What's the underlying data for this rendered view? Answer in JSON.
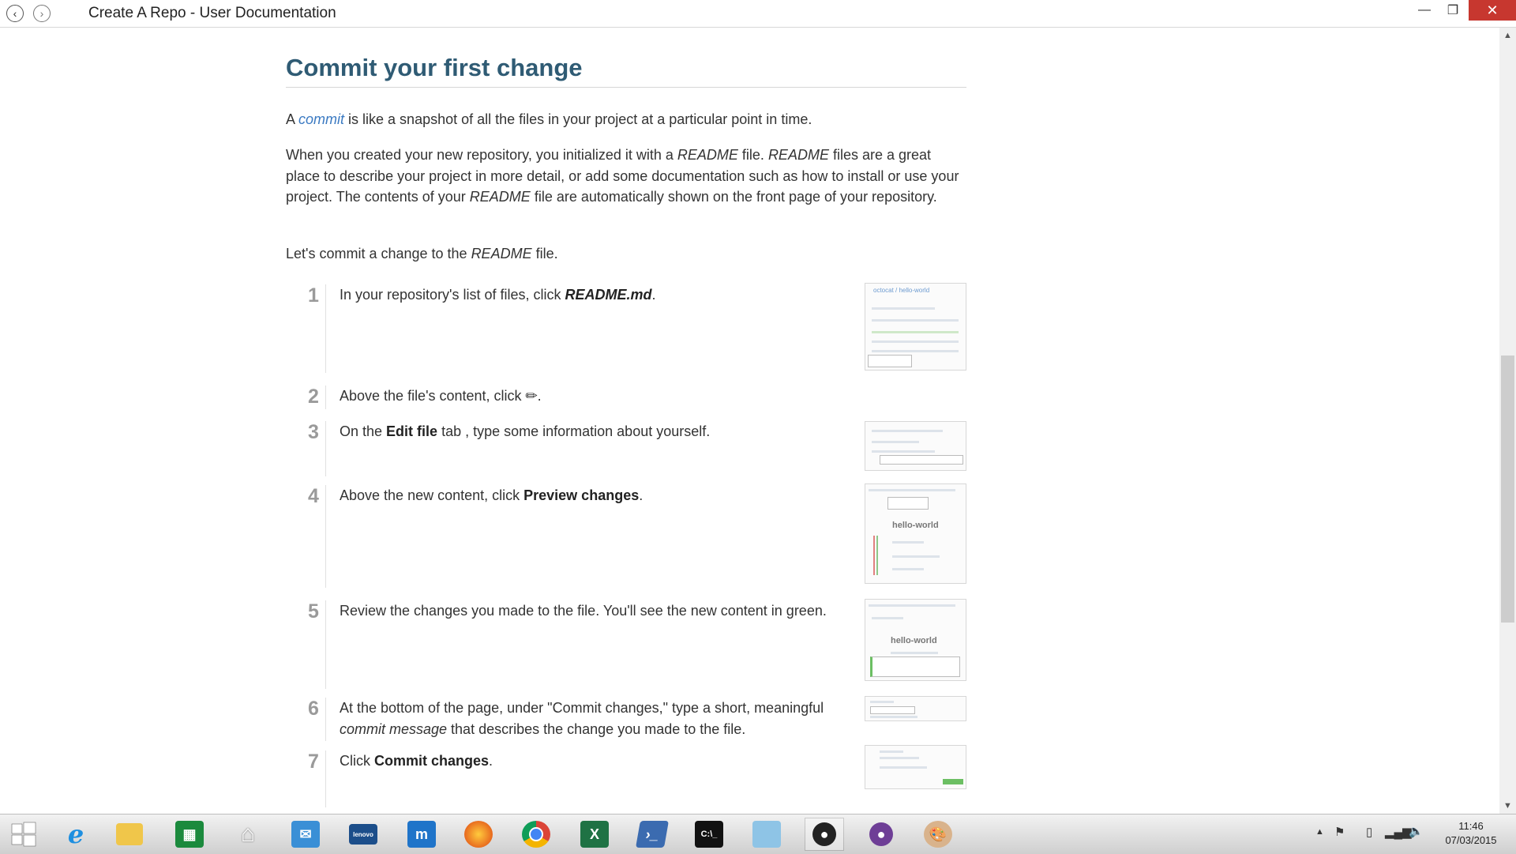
{
  "window": {
    "title": "Create A Repo - User Documentation",
    "back_icon": "back-arrow-icon",
    "forward_icon": "forward-arrow-icon"
  },
  "article": {
    "heading": "Commit your first change",
    "intro": {
      "prefix": "A",
      "link": "commit",
      "suffix": " is like a snapshot of all the files in your project at a particular point in time."
    },
    "para2": {
      "t1": "When you created your new repository, you initialized it with a ",
      "readme1": "README",
      "t2": " file. ",
      "readme2": "README",
      "t3": " files are a great place to describe your project in more detail, or add some documentation such as how to install or use your project. The contents of your ",
      "readme3": "README",
      "t4": " file are automatically shown on the front page of your repository."
    },
    "para3": {
      "t1": "Let's commit a change to the ",
      "readme": "README",
      "t2": " file."
    },
    "steps": [
      {
        "num": "1",
        "pre": "In your repository's list of files, click ",
        "bold": "README.md",
        "post": "."
      },
      {
        "num": "2",
        "pre": "Above the file's content, click ",
        "icon": "pencil-icon",
        "post": "."
      },
      {
        "num": "3",
        "pre": "On the ",
        "bold": "Edit file",
        "post": " tab , type some information about yourself."
      },
      {
        "num": "4",
        "pre": "Above the new content, click ",
        "bold": "Preview changes",
        "post": "."
      },
      {
        "num": "5",
        "pre": "Review the changes you made to the file. You'll see the new content in green."
      },
      {
        "num": "6",
        "pre": "At the bottom of the page, under \"Commit changes,\" type a short, meaningful ",
        "em": "commit message",
        "post": " that describes the change you made to the file."
      },
      {
        "num": "7",
        "pre": "Click ",
        "bold": "Commit changes",
        "post": "."
      }
    ],
    "thumbs": {
      "t1_title": "octocat / hello-world",
      "t4_title": "hello-world",
      "t5_title": "hello-world"
    }
  },
  "taskbar": {
    "items": [
      "windows-start-icon",
      "internet-explorer-icon",
      "file-explorer-icon",
      "store-icon",
      "home-icon",
      "mail-icon",
      "lenovo-monitor-icon",
      "maxthon-icon",
      "firefox-icon",
      "chrome-icon",
      "excel-icon",
      "powershell-icon",
      "command-prompt-icon",
      "notepad-icon",
      "github-icon",
      "github-desktop-icon",
      "paint-icon"
    ],
    "time": "11:46",
    "date": "07/03/2015"
  }
}
